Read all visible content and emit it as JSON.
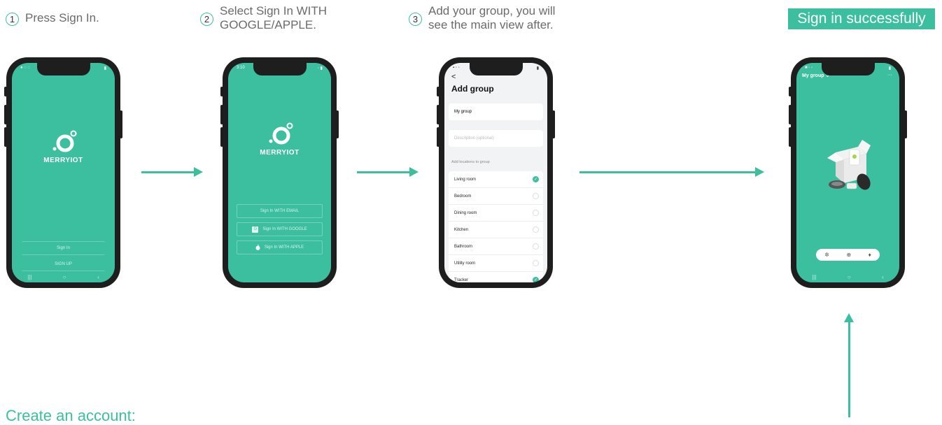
{
  "steps": [
    {
      "num": "1",
      "text": "Press Sign In."
    },
    {
      "num": "2",
      "text": "Select Sign In WITH\nGOOGLE/APPLE."
    },
    {
      "num": "3",
      "text": "Add your group, you will\nsee the main view after."
    }
  ],
  "success_label": "Sign in successfully",
  "create_label": "Create an account:",
  "colors": {
    "accent": "#3cbf9f",
    "phone_body": "#1e1e1e"
  },
  "phone1": {
    "brand": "MERRYIOT",
    "buttons": [
      "Sign In",
      "SIGN UP"
    ]
  },
  "phone2": {
    "brand": "MERRYIOT",
    "time": "3:10",
    "buttons": [
      "Sign In WITH EMAIL",
      "Sign In WITH GOOGLE",
      "Sign In WITH APPLE"
    ]
  },
  "phone3": {
    "title": "Add group",
    "back": "<",
    "name_value": "My group",
    "description_placeholder": "Description (optional)",
    "section": "Add locations to group",
    "locations": [
      {
        "label": "Living room",
        "checked": true
      },
      {
        "label": "Bedroom",
        "checked": false
      },
      {
        "label": "Dining room",
        "checked": false
      },
      {
        "label": "Kitchen",
        "checked": false
      },
      {
        "label": "Bathroom",
        "checked": false
      },
      {
        "label": "Utility room",
        "checked": false
      },
      {
        "label": "Tracker",
        "checked": true
      }
    ]
  },
  "phone4": {
    "group": "My group ⌄",
    "more": "···",
    "toolbar_icons": [
      "gear-icon",
      "plus-circle-icon",
      "bell-icon"
    ]
  }
}
